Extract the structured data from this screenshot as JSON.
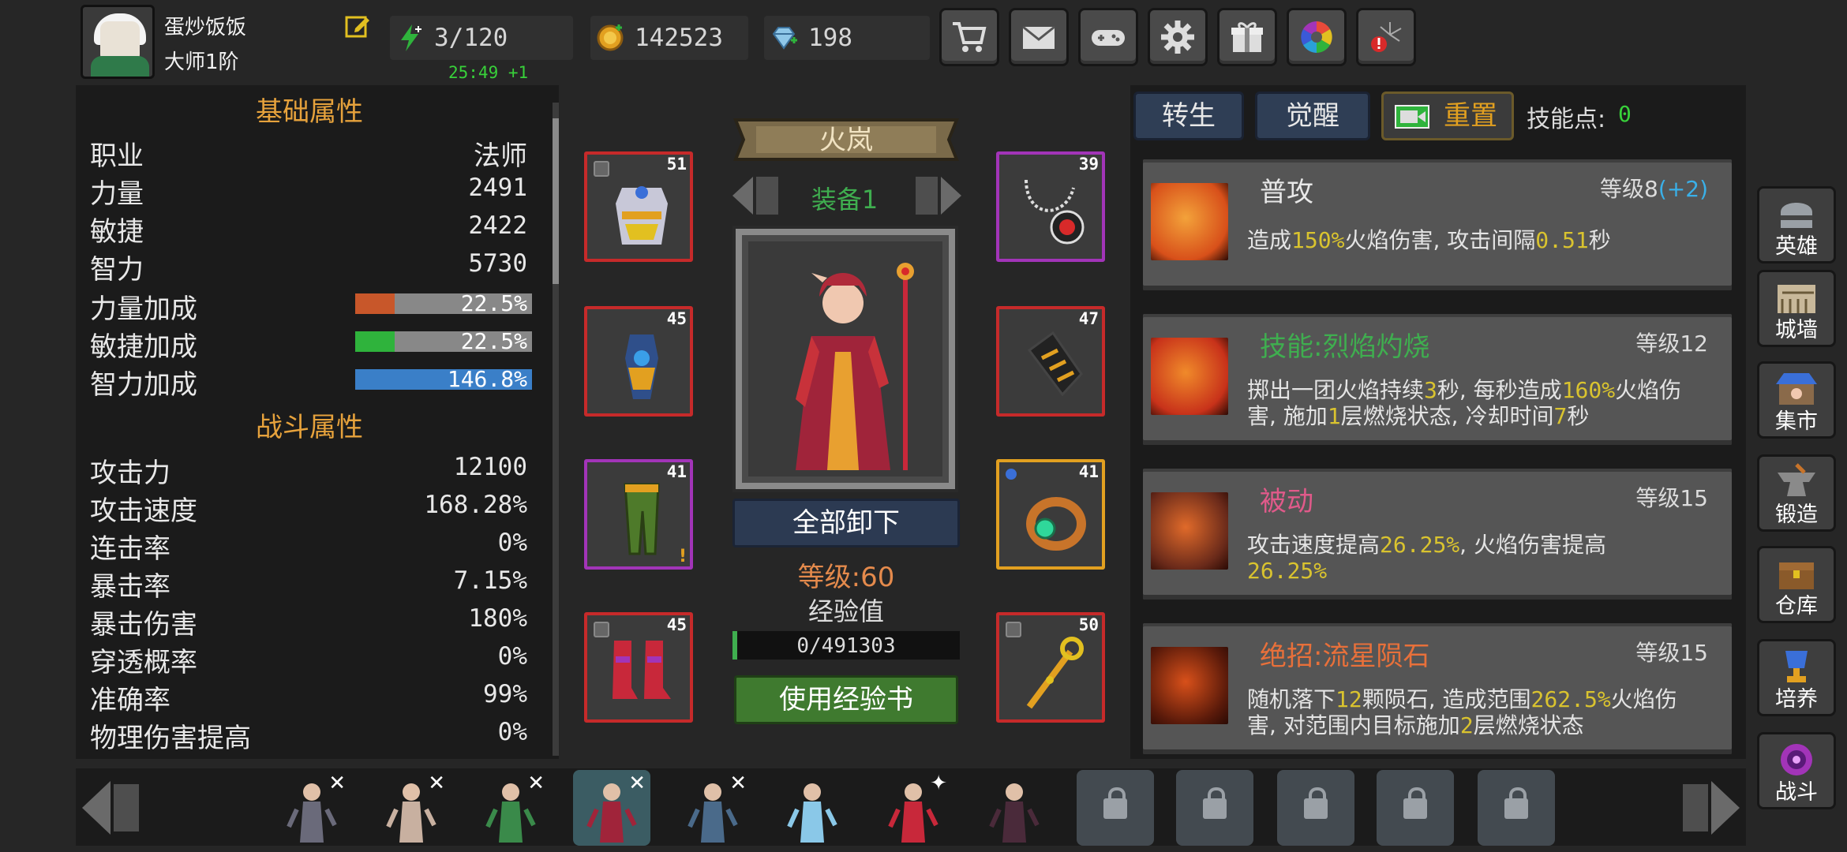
{
  "player": {
    "name": "蛋炒饭饭",
    "rank": "大师1阶"
  },
  "resources": {
    "energy": "3/120",
    "energy_timer": "25:49 +1",
    "gold": "142523",
    "gems": "198"
  },
  "top_buttons": [
    "cart-icon",
    "mail-icon",
    "gamepad-icon",
    "gear-icon",
    "gift-icon",
    "color-wheel-icon",
    "firework-alert-icon"
  ],
  "basic_attrs": {
    "title": "基础属性",
    "rows": [
      {
        "label": "职业",
        "value": "法师"
      },
      {
        "label": "力量",
        "value": "2491"
      },
      {
        "label": "敏捷",
        "value": "2422"
      },
      {
        "label": "智力",
        "value": "5730"
      }
    ],
    "bonuses": [
      {
        "label": "力量加成",
        "value": "22.5%",
        "fill": 0.225,
        "color": "#c8572a"
      },
      {
        "label": "敏捷加成",
        "value": "22.5%",
        "fill": 0.225,
        "color": "#2fb33c"
      },
      {
        "label": "智力加成",
        "value": "146.8%",
        "fill": 1.0,
        "color": "#3a7fc8"
      }
    ]
  },
  "combat_attrs": {
    "title": "战斗属性",
    "rows": [
      {
        "label": "攻击力",
        "value": "12100"
      },
      {
        "label": "攻击速度",
        "value": "168.28%"
      },
      {
        "label": "连击率",
        "value": "0%"
      },
      {
        "label": "暴击率",
        "value": "7.15%"
      },
      {
        "label": "暴击伤害",
        "value": "180%"
      },
      {
        "label": "穿透概率",
        "value": "0%"
      },
      {
        "label": "准确率",
        "value": "99%"
      },
      {
        "label": "物理伤害提高",
        "value": "0%"
      }
    ]
  },
  "hero": {
    "name": "火岚",
    "equip_set": "装备1",
    "unequip_all": "全部卸下",
    "level": "等级:60",
    "exp_label": "经验值",
    "exp": "0/491303",
    "use_exp_book": "使用经验书"
  },
  "equipment": {
    "left": [
      {
        "slot": "chest-armor",
        "level": "51",
        "rarity": "red"
      },
      {
        "slot": "belt",
        "level": "45",
        "rarity": "red"
      },
      {
        "slot": "leggings",
        "level": "41",
        "rarity": "purple"
      },
      {
        "slot": "boots",
        "level": "45",
        "rarity": "red"
      }
    ],
    "right": [
      {
        "slot": "necklace",
        "level": "39",
        "rarity": "purple"
      },
      {
        "slot": "gloves",
        "level": "47",
        "rarity": "red"
      },
      {
        "slot": "ring",
        "level": "41",
        "rarity": "gold"
      },
      {
        "slot": "staff",
        "level": "50",
        "rarity": "red"
      }
    ]
  },
  "skills_panel": {
    "tab_rebirth": "转生",
    "tab_awaken": "觉醒",
    "reset": "重置",
    "skill_points_label": "技能点:",
    "skill_points": "0",
    "skills": [
      {
        "name": "普攻",
        "name_color": "#e8e8e8",
        "level": "等级8",
        "level_bonus": "(+2)",
        "desc": [
          [
            {
              "t": "造成"
            },
            {
              "t": "150%",
              "h": true
            },
            {
              "t": "火焰伤害, 攻击间隔"
            },
            {
              "t": "0.51",
              "h": true
            },
            {
              "t": "秒"
            }
          ]
        ]
      },
      {
        "name": "技能:烈焰灼烧",
        "name_color": "#3fae4f",
        "level": "等级12",
        "level_bonus": "",
        "desc": [
          [
            {
              "t": "掷出一团火焰持续"
            },
            {
              "t": "3",
              "h": true
            },
            {
              "t": "秒, 每秒造成"
            },
            {
              "t": "160%",
              "h": true
            },
            {
              "t": "火焰伤"
            }
          ],
          [
            {
              "t": "害, 施加"
            },
            {
              "t": "1",
              "h": true
            },
            {
              "t": "层燃烧状态, 冷却时间"
            },
            {
              "t": "7",
              "h": true
            },
            {
              "t": "秒"
            }
          ]
        ]
      },
      {
        "name": "被动",
        "name_color": "#e05a8a",
        "level": "等级15",
        "level_bonus": "",
        "desc": [
          [
            {
              "t": "攻击速度提高"
            },
            {
              "t": "26.25%",
              "h": true
            },
            {
              "t": ", 火焰伤害提高"
            }
          ],
          [
            {
              "t": "26.25%",
              "h": true
            }
          ]
        ]
      },
      {
        "name": "绝招:流星陨石",
        "name_color": "#e8703a",
        "level": "等级15",
        "level_bonus": "",
        "desc": [
          [
            {
              "t": "随机落下"
            },
            {
              "t": "12",
              "h": true
            },
            {
              "t": "颗陨石, 造成范围"
            },
            {
              "t": "262.5%",
              "h": true
            },
            {
              "t": "火焰伤"
            }
          ],
          [
            {
              "t": "害, 对范围内目标施加"
            },
            {
              "t": "2",
              "h": true
            },
            {
              "t": "层燃烧状态"
            }
          ]
        ]
      }
    ]
  },
  "side_menu": [
    {
      "label": "英雄",
      "icon": "helmet-icon"
    },
    {
      "label": "城墙",
      "icon": "colosseum-icon"
    },
    {
      "label": "集市",
      "icon": "market-icon"
    },
    {
      "label": "锻造",
      "icon": "anvil-icon"
    },
    {
      "label": "仓库",
      "icon": "chest-icon"
    },
    {
      "label": "培养",
      "icon": "trophy-icon"
    },
    {
      "label": "战斗",
      "icon": "portal-icon"
    }
  ],
  "hero_roster": [
    {
      "hero": "swordsman",
      "state": "unlocked-x"
    },
    {
      "hero": "huntress",
      "state": "unlocked-x"
    },
    {
      "hero": "elf-archer",
      "state": "unlocked-x"
    },
    {
      "hero": "fire-mage",
      "state": "selected-x"
    },
    {
      "hero": "dwarf-gunner",
      "state": "unlocked-x"
    },
    {
      "hero": "ice-sorceress",
      "state": "unlocked"
    },
    {
      "hero": "crimson-witch",
      "state": "unlocked-star"
    },
    {
      "hero": "dark-knight",
      "state": "unlocked"
    },
    {
      "hero": "locked-1",
      "state": "locked"
    },
    {
      "hero": "locked-2",
      "state": "locked"
    },
    {
      "hero": "locked-3",
      "state": "locked"
    },
    {
      "hero": "locked-4",
      "state": "locked"
    },
    {
      "hero": "locked-5",
      "state": "locked"
    }
  ]
}
